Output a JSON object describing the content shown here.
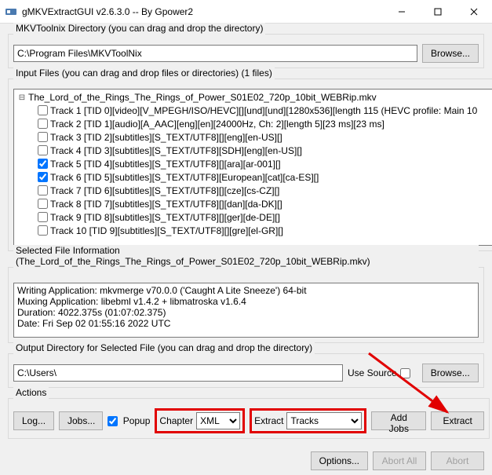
{
  "window": {
    "title": "gMKVExtractGUI v2.6.3.0 -- By Gpower2"
  },
  "dirGroup": {
    "legend": "MKVToolnix Directory (you can drag and drop the directory)",
    "path": "C:\\Program Files\\MKVToolNix",
    "browse": "Browse..."
  },
  "inputGroup": {
    "legend": "Input Files (you can drag and drop files or directories) (1 files)",
    "fileName": "The_Lord_of_the_Rings_The_Rings_of_Power_S01E02_720p_10bit_WEBRip.mkv",
    "tracks": [
      {
        "checked": false,
        "label": "Track 1 [TID 0][video][V_MPEGH/ISO/HEVC][][und][und][1280x536][length 115 (HEVC profile: Main 10"
      },
      {
        "checked": false,
        "label": "Track 2 [TID 1][audio][A_AAC][eng][en][24000Hz, Ch: 2][length 5][23 ms][23 ms]"
      },
      {
        "checked": false,
        "label": "Track 3 [TID 2][subtitles][S_TEXT/UTF8][][eng][en-US][]"
      },
      {
        "checked": false,
        "label": "Track 4 [TID 3][subtitles][S_TEXT/UTF8][SDH][eng][en-US][]"
      },
      {
        "checked": true,
        "label": "Track 5 [TID 4][subtitles][S_TEXT/UTF8][][ara][ar-001][]"
      },
      {
        "checked": true,
        "label": "Track 6 [TID 5][subtitles][S_TEXT/UTF8][European][cat][ca-ES][]"
      },
      {
        "checked": false,
        "label": "Track 7 [TID 6][subtitles][S_TEXT/UTF8][][cze][cs-CZ][]"
      },
      {
        "checked": false,
        "label": "Track 8 [TID 7][subtitles][S_TEXT/UTF8][][dan][da-DK][]"
      },
      {
        "checked": false,
        "label": "Track 9 [TID 8][subtitles][S_TEXT/UTF8][][ger][de-DE][]"
      },
      {
        "checked": false,
        "label": "Track 10 [TID 9][subtitles][S_TEXT/UTF8][][gre][el-GR][]"
      }
    ]
  },
  "selInfo": {
    "legend": "Selected File Information (The_Lord_of_the_Rings_The_Rings_of_Power_S01E02_720p_10bit_WEBRip.mkv)",
    "line1": "Writing Application: mkvmerge v70.0.0 ('Caught A Lite Sneeze') 64-bit",
    "line2": "Muxing Application: libebml v1.4.2 + libmatroska v1.6.4",
    "line3": "Duration: 4022.375s (01:07:02.375)",
    "line4": "Date: Fri Sep 02 01:55:16 2022 UTC"
  },
  "outDir": {
    "legend": "Output Directory for Selected File (you can drag and drop the directory)",
    "path": "C:\\Users\\",
    "useSource": "Use Source",
    "browse": "Browse..."
  },
  "actions": {
    "legend": "Actions",
    "log": "Log...",
    "jobs": "Jobs...",
    "popup": "Popup",
    "chapterLbl": "Chapter",
    "chapterSel": "XML",
    "extractLbl": "Extract",
    "extractSel": "Tracks",
    "addJobs": "Add Jobs",
    "extract": "Extract"
  },
  "bottom": {
    "options": "Options...",
    "abortAll": "Abort All",
    "abort": "Abort"
  }
}
